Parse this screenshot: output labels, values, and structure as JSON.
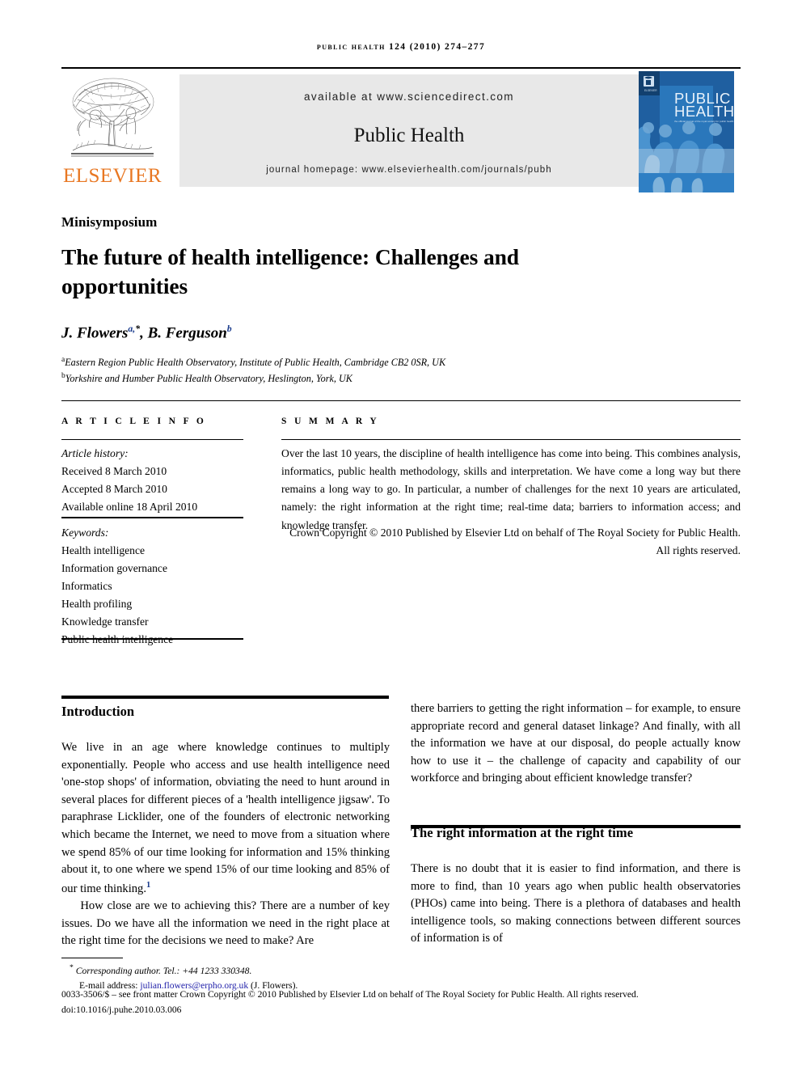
{
  "running_head": "Public Health 124 (2010) 274–277",
  "masthead": {
    "publisher_logo_name": "elsevier-logo",
    "publisher_wordmark": "ELSEVIER",
    "available_at": "available at www.sciencedirect.com",
    "journal_name": "Public Health",
    "journal_homepage": "journal homepage: www.elsevierhealth.com/journals/pubh",
    "cover": {
      "line1": "PUBLIC",
      "line2": "HEALTH",
      "tagline": "The official journal of the Royal Society for Public Health",
      "colors": {
        "dark_blue": "#1f5fa0",
        "mid_blue": "#2f7fc4",
        "light_blue": "#6fa8d6",
        "pale_blue": "#a9c9e4",
        "paler_blue": "#cfe0f0"
      }
    },
    "accent_orange": "#E87722",
    "box_gray": "#E8E8E8"
  },
  "article": {
    "section_label": "Minisymposium",
    "title": "The future of health intelligence: Challenges and opportunities",
    "authors_html": "J. Flowers <sup>a,*</sup>, B. Ferguson <sup>b</sup>",
    "authors_plain": "J. Flowers a,*, B. Ferguson b",
    "affiliations": [
      {
        "marker": "a",
        "text": "Eastern Region Public Health Observatory, Institute of Public Health, Cambridge CB2 0SR, UK"
      },
      {
        "marker": "b",
        "text": "Yorkshire and Humber Public Health Observatory, Heslington, York, UK"
      }
    ]
  },
  "info": {
    "heading": "A R T I C L E   I N F O",
    "history_label": "Article history:",
    "history": [
      "Received 8 March 2010",
      "Accepted 8 March 2010",
      "Available online 18 April 2010"
    ],
    "keywords_label": "Keywords:",
    "keywords": [
      "Health intelligence",
      "Information governance",
      "Informatics",
      "Health profiling",
      "Knowledge transfer",
      "Public health intelligence"
    ]
  },
  "summary": {
    "heading": "S U M M A R Y",
    "text": "Over the last 10 years, the discipline of health intelligence has come into being. This combines analysis, informatics, public health methodology, skills and interpretation. We have come a long way but there remains a long way to go. In particular, a number of challenges for the next 10 years are articulated, namely: the right information at the right time; real-time data; barriers to information access; and knowledge transfer.",
    "copyright": "Crown Copyright © 2010 Published by Elsevier Ltd on behalf of The Royal Society for Public Health. All rights reserved."
  },
  "body": {
    "left": {
      "heading": "Introduction",
      "paragraph_1_a": "We live in an age where knowledge continues to multiply exponentially. People who access and use health intelligence need 'one-stop shops' of information, obviating the need to hunt around in several places for different pieces of a 'health intelligence jigsaw'. To paraphrase Licklider, one of the founders of electronic networking which became the Internet, we need to move from a situation where we spend 85% of our time looking for information and 15% thinking about it, to one where we spend 15% of our time looking and 85% of our time thinking.",
      "paragraph_1_ref": "1",
      "paragraph_2": "How close are we to achieving this? There are a number of key issues. Do we have all the information we need in the right place at the right time for the decisions we need to make? Are"
    },
    "right": {
      "paragraph_1": "there barriers to getting the right information – for example, to ensure appropriate record and general dataset linkage? And finally, with all the information we have at our disposal, do people actually know how to use it – the challenge of capacity and capability of our workforce and bringing about efficient knowledge transfer?",
      "heading": "The right information at the right time",
      "paragraph_2": "There is no doubt that it is easier to find information, and there is more to find, than 10 years ago when public health observatories (PHOs) came into being. There is a plethora of databases and health intelligence tools, so making connections between different sources of information is of"
    }
  },
  "footnotes": {
    "corresponding_marker": "*",
    "corresponding": "Corresponding author. Tel.: +44 1233 330348.",
    "email_label": "E-mail address:",
    "email": "julian.flowers@erpho.org.uk",
    "email_attrib": "(J. Flowers).",
    "email_color": "#2222aa"
  },
  "copyright_footer": {
    "line1": "0033-3506/$ – see front matter Crown Copyright © 2010 Published by Elsevier Ltd on behalf of The Royal Society for Public Health. All rights reserved.",
    "line2": "doi:10.1016/j.puhe.2010.03.006"
  }
}
